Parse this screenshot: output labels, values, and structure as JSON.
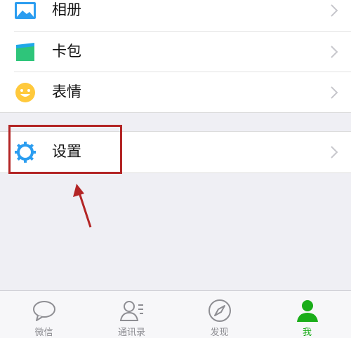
{
  "menu_top": [
    {
      "label": "相册",
      "icon": "album-icon"
    },
    {
      "label": "卡包",
      "icon": "card-wallet-icon"
    },
    {
      "label": "表情",
      "icon": "sticker-smiley-icon"
    }
  ],
  "settings": {
    "label": "设置",
    "icon": "settings-gear-icon"
  },
  "tabbar": {
    "items": [
      {
        "label": "微信",
        "icon": "chat-bubble-icon",
        "active": false
      },
      {
        "label": "通讯录",
        "icon": "contacts-icon",
        "active": false
      },
      {
        "label": "发现",
        "icon": "compass-icon",
        "active": false
      },
      {
        "label": "我",
        "icon": "me-person-icon",
        "active": true
      }
    ]
  },
  "colors": {
    "accent_green": "#1aad19",
    "annotation_red": "#b32525",
    "icon_blue": "#2b9df0"
  }
}
